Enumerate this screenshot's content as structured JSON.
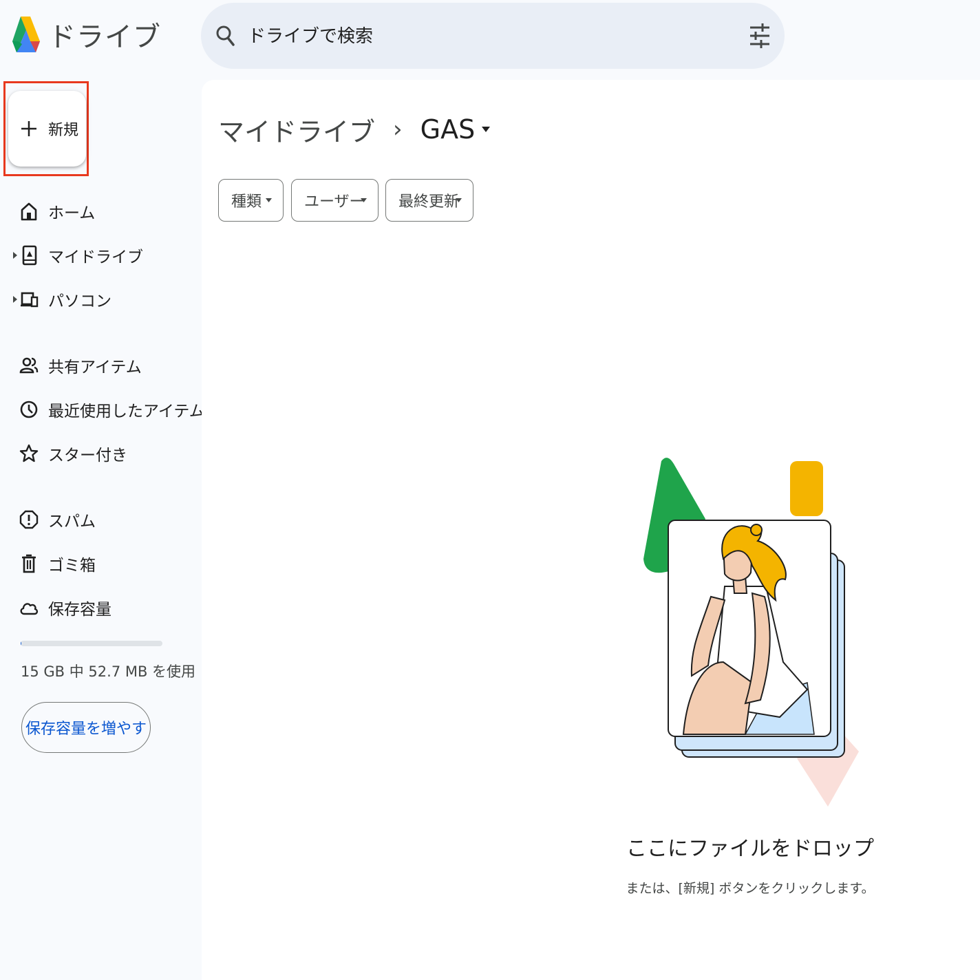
{
  "app": {
    "name": "ドライブ"
  },
  "search": {
    "placeholder": "ドライブで検索"
  },
  "new_button": {
    "label": "新規"
  },
  "sidebar": {
    "items": [
      {
        "label": "ホーム",
        "icon": "home-icon",
        "expandable": false
      },
      {
        "label": "マイドライブ",
        "icon": "my-drive-icon",
        "expandable": true
      },
      {
        "label": "パソコン",
        "icon": "computers-icon",
        "expandable": true
      },
      {
        "label": "共有アイテム",
        "icon": "shared-icon",
        "expandable": false
      },
      {
        "label": "最近使用したアイテム",
        "icon": "clock-icon",
        "expandable": false
      },
      {
        "label": "スター付き",
        "icon": "star-icon",
        "expandable": false
      },
      {
        "label": "スパム",
        "icon": "spam-icon",
        "expandable": false
      },
      {
        "label": "ゴミ箱",
        "icon": "trash-icon",
        "expandable": false
      },
      {
        "label": "保存容量",
        "icon": "cloud-icon",
        "expandable": false
      }
    ]
  },
  "storage": {
    "usage_text": "15 GB 中 52.7 MB を使用",
    "used_fraction": 0.0034,
    "button_label": "保存容量を増やす"
  },
  "breadcrumb": {
    "root": "マイドライブ",
    "separator": "›",
    "current": "GAS"
  },
  "filters": [
    {
      "label": "種類"
    },
    {
      "label": "ユーザー"
    },
    {
      "label": "最終更新"
    }
  ],
  "empty_state": {
    "title": "ここにファイルをドロップ",
    "subtitle": "または、[新規] ボタンをクリックします。"
  },
  "colors": {
    "accent": "#0b57d0",
    "highlight": "#e8391e",
    "search_bg": "#e9eef6",
    "sidebar_bg": "#f8fafd"
  }
}
